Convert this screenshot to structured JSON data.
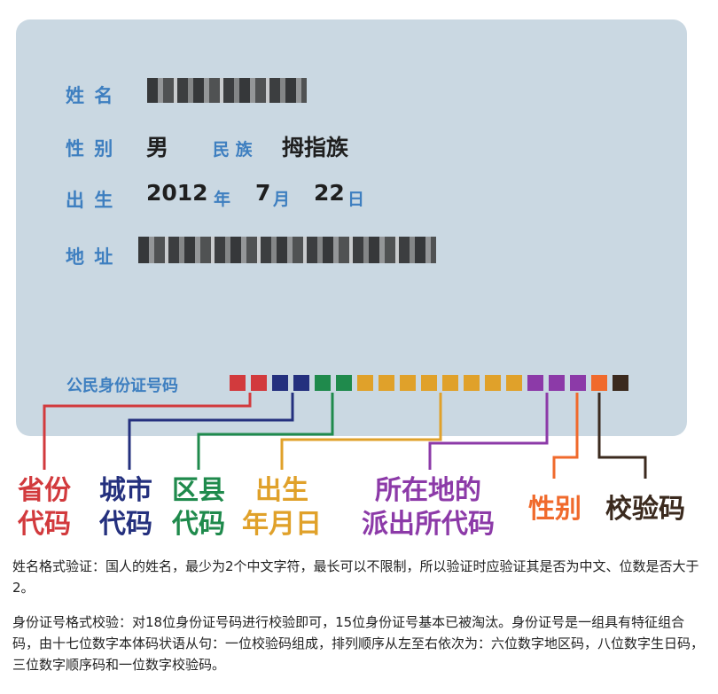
{
  "card": {
    "name_label": "姓 名",
    "gender_label": "性 别",
    "gender_value": "男",
    "ethnic_label": "民 族",
    "ethnic_value": "拇指族",
    "birth_label": "出 生",
    "birth_year": "2012",
    "year_unit": "年",
    "birth_month": "7",
    "month_unit": "月",
    "birth_day": "22",
    "day_unit": "日",
    "address_label": "地 址",
    "id_label": "公民身份证号码"
  },
  "segments": [
    {
      "label_line1": "省份",
      "label_line2": "代码",
      "color": "#d23a3d"
    },
    {
      "label_line1": "城市",
      "label_line2": "代码",
      "color": "#24307e"
    },
    {
      "label_line1": "区县",
      "label_line2": "代码",
      "color": "#1f8a4c"
    },
    {
      "label_line1": "出生",
      "label_line2": "年月日",
      "color": "#e0a12a"
    },
    {
      "label_line1": "所在地的",
      "label_line2": "派出所代码",
      "color": "#8c3aa8"
    },
    {
      "label_line1": "性别",
      "label_line2": "",
      "color": "#f06a2c"
    },
    {
      "label_line1": "校验码",
      "label_line2": "",
      "color": "#3b2a1e"
    }
  ],
  "text": {
    "para1": "姓名格式验证：国人的姓名，最少为2个中文字符，最长可以不限制，所以验证时应验证其是否为中文、位数是否大于2。",
    "para2": "身份证号格式校验：对18位身份证号码进行校验即可，15位身份证号基本已被淘汰。身份证号是一组具有特征组合码，由十七位数字本体码状语从句：一位校验码组成，排列顺序从左至右依次为：六位数字地区码，八位数字生日码，三位数字顺序码和一位数字校验码。"
  }
}
